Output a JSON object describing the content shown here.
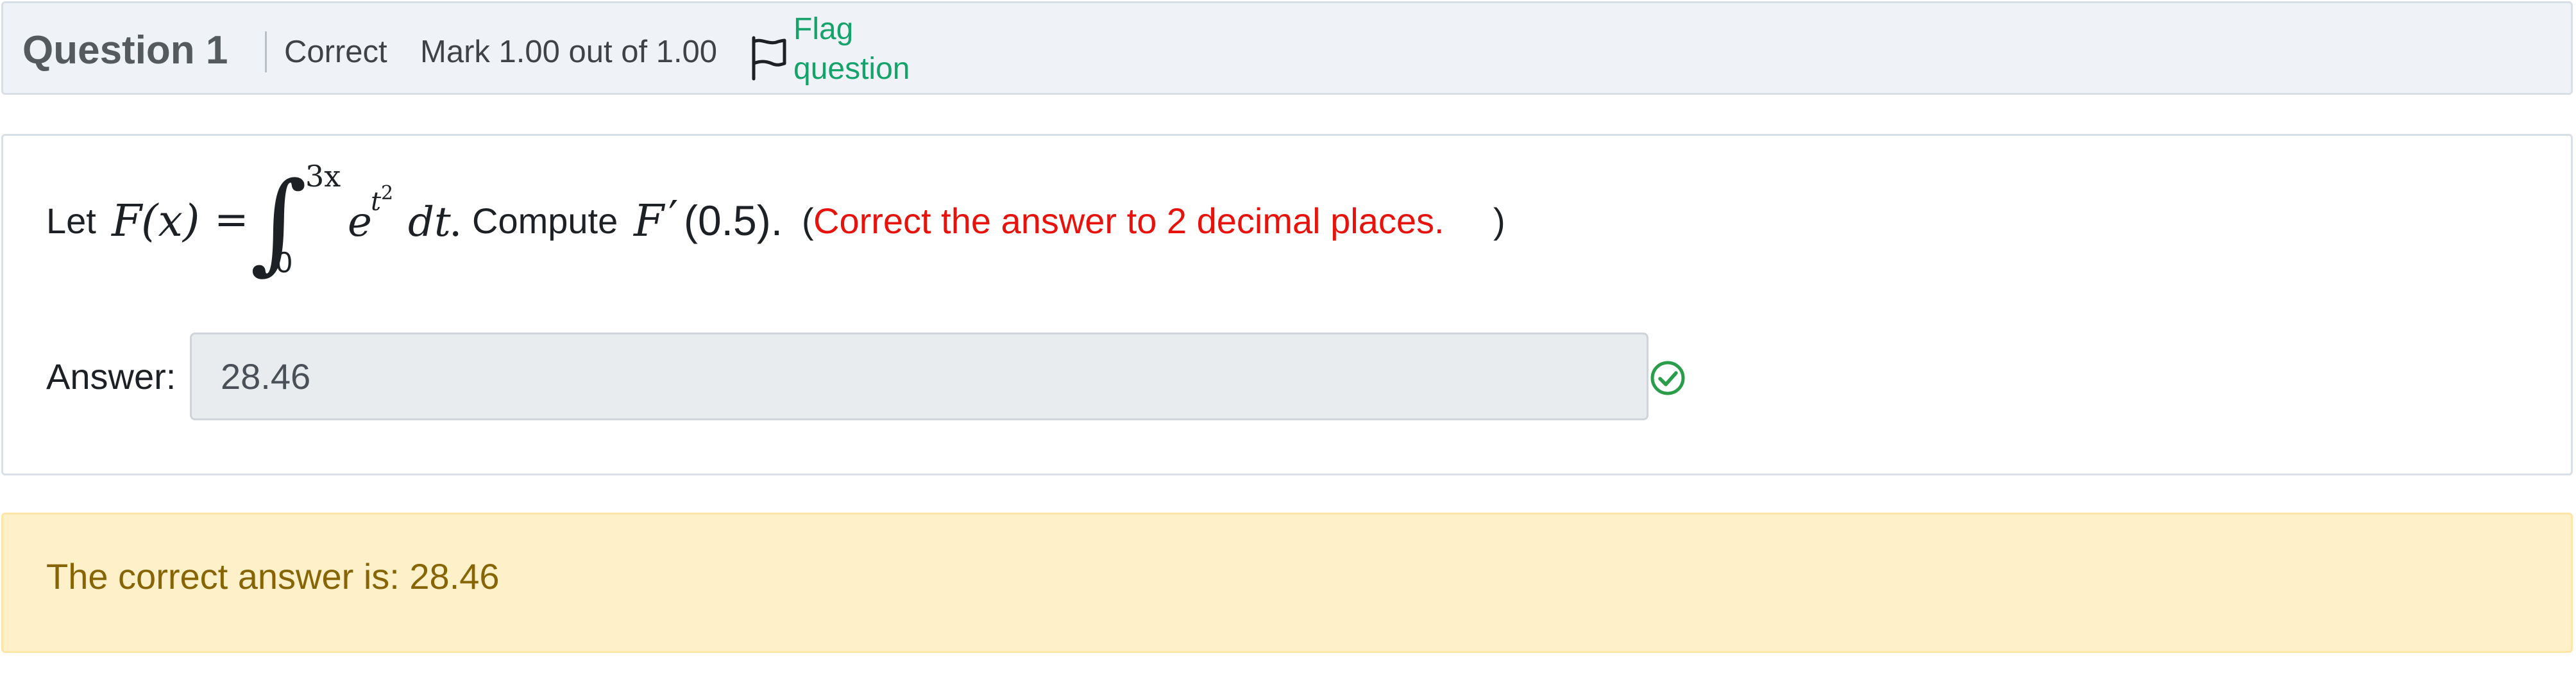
{
  "header": {
    "title": "Question 1",
    "state": "Correct",
    "grade": "Mark 1.00 out of 1.00",
    "flag_label": "Flag\nquestion"
  },
  "question": {
    "prefix": "Let",
    "function_name": "F",
    "variable": "(x)",
    "equals": "=",
    "integral_sign": "∫",
    "upper_limit": "3x",
    "lower_limit": "0",
    "integrand_base": "e",
    "integrand_exp_base": "t",
    "integrand_exp_power": "2",
    "differential": "dt",
    "period": ".",
    "instruction": "Compute",
    "derivative_name": "F",
    "prime": "′",
    "argument": "(0.5).",
    "note_open": "(",
    "note": "Correct the answer to 2 decimal places.",
    "note_close": ")"
  },
  "answer": {
    "label": "Answer:",
    "value": "28.46",
    "status": "correct"
  },
  "feedback": {
    "text": "The correct answer is: 28.46"
  },
  "colors": {
    "header_bg": "#eff3f7",
    "link_green": "#14a36a",
    "note_red": "#e8120c",
    "check_green": "#2a9d4a",
    "feedback_bg": "#fef0c8",
    "feedback_text": "#876504"
  },
  "icons": {
    "flag": "flag-outline-icon",
    "correct": "check-circle-icon"
  }
}
